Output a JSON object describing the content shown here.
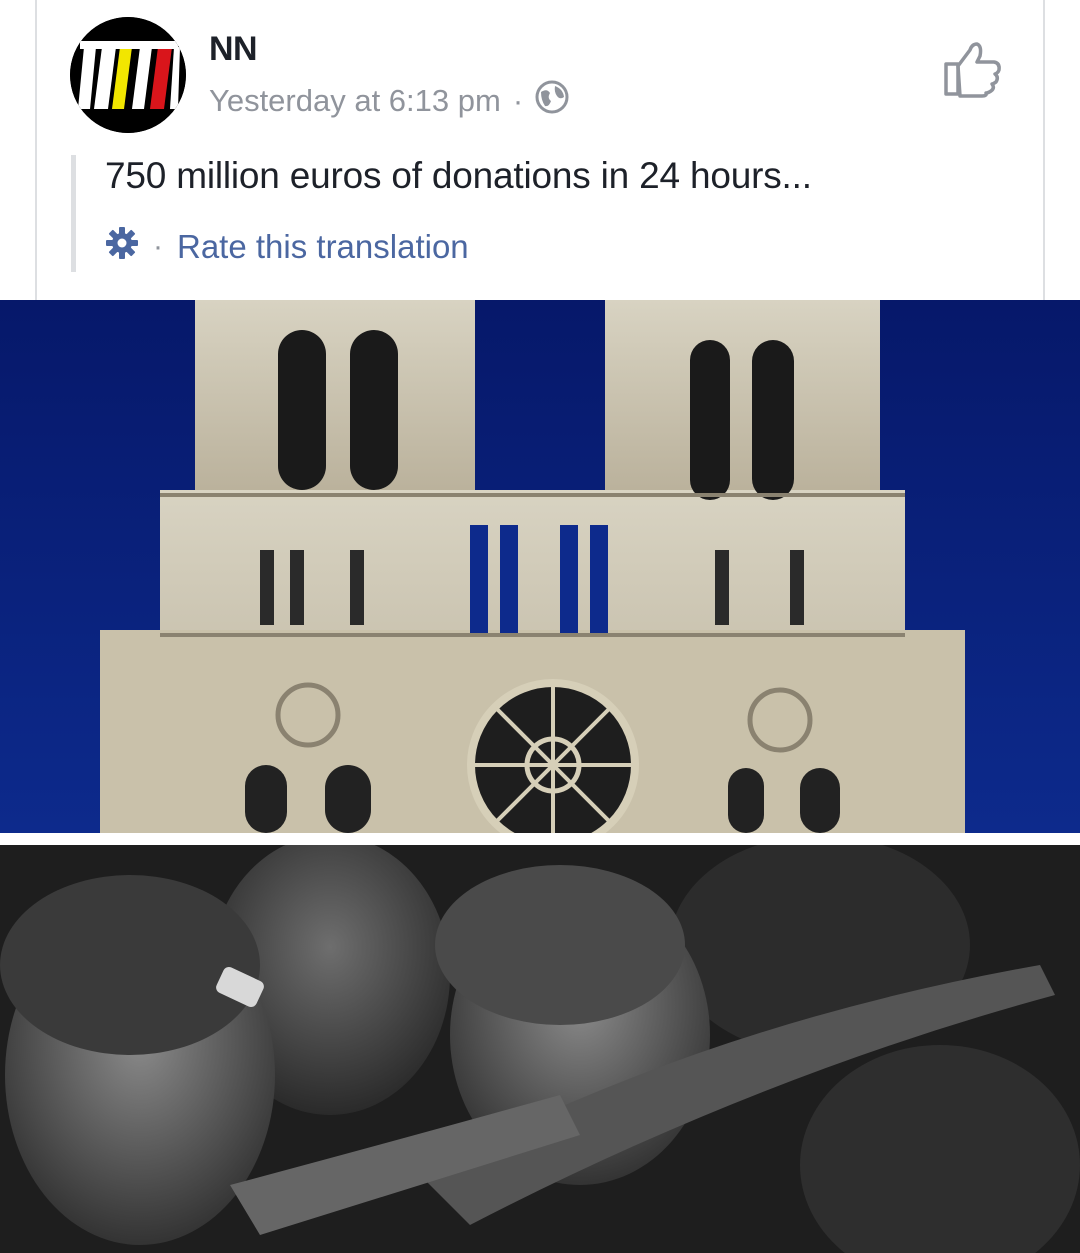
{
  "post": {
    "author": "NN",
    "timestamp": "Yesterday at 6:13 pm",
    "separator": "·",
    "privacy_icon": "globe-icon",
    "text": "750 million euros of donations in 24 hours...",
    "translation": {
      "separator": "·",
      "rate_label": "Rate this translation",
      "icon": "gear-icon"
    },
    "like_icon": "thumbs-up-icon"
  },
  "colors": {
    "link": "#4b67a1",
    "meta": "#90949c",
    "text": "#1d2129",
    "sky": "#0a1e78"
  }
}
